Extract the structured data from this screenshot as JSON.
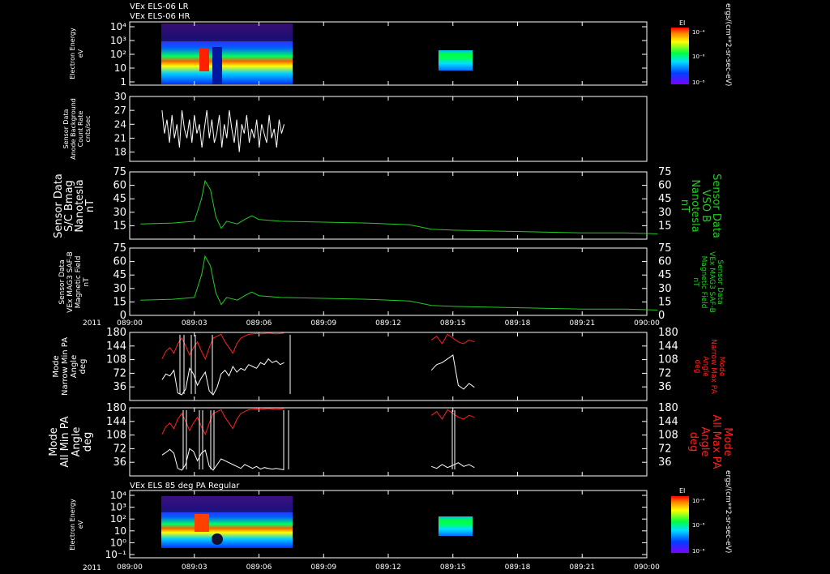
{
  "header": {
    "line1": "VEx ELS-06 LR",
    "line2": "VEx ELS-06 HR"
  },
  "time_axis": {
    "year": "2011",
    "ticks": [
      "089:00",
      "089:03",
      "089:06",
      "089:09",
      "089:12",
      "089:15",
      "089:18",
      "089:21",
      "090:00"
    ]
  },
  "colorbar": {
    "title": "EI",
    "unit": "ergs/(cm**2-sr-sec-eV)",
    "ticks": [
      "10⁻⁴",
      "10⁻⁶",
      "10⁻⁸"
    ]
  },
  "chart_data": [
    {
      "type": "heatmap",
      "id": "spectrogram-top",
      "ylabel": [
        "Electron Energy",
        "eV"
      ],
      "ytick_labels": [
        "10⁴",
        "10³",
        "10²",
        "10",
        "1"
      ],
      "data_blocks": [
        {
          "t_start": "089:01:30",
          "t_end": "089:07:15",
          "energy_min_eV": 3,
          "energy_max_eV": 20000
        },
        {
          "t_start": "089:14:00",
          "t_end": "089:15:30",
          "energy_min_eV": 10,
          "energy_max_eV": 200
        }
      ]
    },
    {
      "type": "line",
      "id": "anode-background",
      "ylabel": [
        "Sensor Data",
        "Anode Background",
        "Count Rate",
        "cnts/sec"
      ],
      "ylim": [
        16,
        30
      ],
      "yticks": [
        30,
        27,
        24,
        21,
        18
      ],
      "series": [
        {
          "color": "#ffffff",
          "t_start": "089:01:30",
          "t_end": "089:07:10",
          "values": [
            27,
            22,
            25,
            20,
            26,
            21,
            24,
            19,
            27,
            23,
            21,
            25,
            20,
            26,
            22,
            24,
            19,
            23,
            27,
            21,
            25,
            20,
            22,
            26,
            19,
            24,
            21,
            27,
            23,
            20,
            25,
            18,
            24,
            22,
            26,
            20,
            23,
            21,
            25,
            19,
            24,
            22,
            20,
            26,
            21,
            23,
            19,
            25,
            22,
            24
          ]
        }
      ]
    },
    {
      "type": "line",
      "id": "sc-bmag",
      "ylabel": [
        "Sensor Data",
        "S/C Bmag",
        "Nanotesla",
        "nT"
      ],
      "ylabel_right": [
        "Sensor Data",
        "VSO B",
        "Nanotesla",
        "nT"
      ],
      "ylim": [
        0,
        75
      ],
      "yticks": [
        75,
        60,
        45,
        30,
        15
      ],
      "series": [
        {
          "color": "#22cc22",
          "t": [
            "089:00:30",
            "089:02:00",
            "089:03:00",
            "089:03:20",
            "089:03:30",
            "089:03:45",
            "089:04:00",
            "089:04:15",
            "089:04:30",
            "089:05:00",
            "089:05:20",
            "089:05:40",
            "089:06:00",
            "089:07:00",
            "089:09:00",
            "089:11:00",
            "089:13:00",
            "089:14:00",
            "089:15:00",
            "089:17:00",
            "089:19:00",
            "089:21:00",
            "089:23:00",
            "089:24:30"
          ],
          "values": [
            17,
            18,
            20,
            45,
            65,
            55,
            25,
            12,
            20,
            17,
            22,
            26,
            22,
            20,
            19,
            18,
            16,
            11,
            10,
            9,
            8,
            7,
            7,
            6
          ]
        }
      ]
    },
    {
      "type": "line",
      "id": "mag-saf-b",
      "ylabel": [
        "Sensor Data",
        "VEx MAG3 SAF-B",
        "Magnetic Field",
        "nT"
      ],
      "ylabel_right": [
        "Sensor Data",
        "VEx MAG3 SAF-B",
        "Magnetic Field",
        "nT"
      ],
      "ylim": [
        0,
        75
      ],
      "yticks": [
        75,
        60,
        45,
        30,
        15,
        0
      ],
      "series": [
        {
          "color": "#22cc22",
          "t": [
            "089:00:30",
            "089:02:00",
            "089:03:00",
            "089:03:20",
            "089:03:30",
            "089:03:45",
            "089:04:00",
            "089:04:15",
            "089:04:30",
            "089:05:00",
            "089:05:20",
            "089:05:40",
            "089:06:00",
            "089:07:00",
            "089:09:00",
            "089:11:00",
            "089:13:00",
            "089:14:00",
            "089:15:00",
            "089:17:00",
            "089:19:00",
            "089:21:00",
            "089:23:00",
            "089:24:30"
          ],
          "values": [
            17,
            18,
            20,
            45,
            66,
            55,
            25,
            12,
            20,
            17,
            22,
            26,
            22,
            20,
            19,
            18,
            16,
            11,
            10,
            9,
            8,
            7,
            7,
            6
          ]
        }
      ]
    },
    {
      "type": "line",
      "id": "narrow-pa",
      "ylabel": [
        "Mode",
        "Narrow Min PA",
        "Angle",
        "deg"
      ],
      "ylabel_right": [
        "Mode",
        "Narrow Max PA",
        "Angle",
        "deg"
      ],
      "ylim": [
        0,
        180
      ],
      "yticks": [
        180,
        144,
        108,
        72,
        36
      ],
      "series": [
        {
          "color": "#ffffff",
          "segments": [
            {
              "t_start": "089:01:30",
              "t_end": "089:07:10",
              "values": [
                55,
                70,
                65,
                80,
                20,
                15,
                30,
                85,
                70,
                40,
                60,
                75,
                25,
                15,
                35,
                70,
                80,
                65,
                90,
                75,
                85,
                80,
                95,
                90,
                85,
                100,
                95,
                110,
                100,
                105,
                95,
                100
              ]
            },
            {
              "t_start": "089:14:00",
              "t_end": "089:16:00",
              "values": [
                80,
                95,
                100,
                110,
                120,
                40,
                30,
                45,
                35
              ]
            }
          ]
        },
        {
          "color": "#ff2020",
          "segments": [
            {
              "t_start": "089:01:30",
              "t_end": "089:07:10",
              "values": [
                110,
                130,
                140,
                125,
                150,
                165,
                145,
                120,
                140,
                155,
                130,
                110,
                140,
                165,
                170,
                175,
                155,
                140,
                125,
                150,
                165,
                170,
                175,
                176,
                177,
                176,
                177,
                178,
                177,
                176,
                177,
                178
              ]
            },
            {
              "t_start": "089:14:00",
              "t_end": "089:16:00",
              "values": [
                160,
                170,
                150,
                175,
                165,
                155,
                150,
                160,
                155
              ]
            }
          ]
        }
      ]
    },
    {
      "type": "line",
      "id": "all-pa",
      "ylabel": [
        "Mode",
        "All Min PA",
        "Angle",
        "deg"
      ],
      "ylabel_right": [
        "Mode",
        "All Max PA",
        "Angle",
        "deg"
      ],
      "ylim": [
        0,
        180
      ],
      "yticks": [
        180,
        144,
        108,
        72,
        36
      ],
      "series": [
        {
          "color": "#ffffff",
          "segments": [
            {
              "t_start": "089:01:30",
              "t_end": "089:07:10",
              "values": [
                55,
                62,
                70,
                60,
                20,
                15,
                30,
                72,
                65,
                40,
                60,
                68,
                25,
                15,
                30,
                45,
                40,
                35,
                30,
                25,
                20,
                30,
                25,
                20,
                25,
                18,
                22,
                20,
                18,
                20,
                18,
                16
              ]
            },
            {
              "t_start": "089:14:00",
              "t_end": "089:16:00",
              "values": [
                25,
                20,
                30,
                22,
                28,
                35,
                25,
                30,
                22
              ]
            }
          ]
        },
        {
          "color": "#ff2020",
          "segments": [
            {
              "t_start": "089:01:30",
              "t_end": "089:07:10",
              "values": [
                110,
                130,
                140,
                125,
                150,
                165,
                145,
                120,
                140,
                155,
                130,
                110,
                140,
                165,
                170,
                175,
                155,
                140,
                125,
                150,
                165,
                170,
                175,
                176,
                177,
                176,
                177,
                178,
                177,
                176,
                177,
                178
              ]
            },
            {
              "t_start": "089:14:00",
              "t_end": "089:16:00",
              "values": [
                160,
                170,
                150,
                175,
                165,
                155,
                150,
                160,
                155
              ]
            }
          ]
        }
      ]
    },
    {
      "type": "heatmap",
      "id": "spectrogram-bottom",
      "title": "VEx ELS 85 deg PA Regular",
      "ylabel": [
        "Electron Energy",
        "eV"
      ],
      "ytick_labels": [
        "10⁴",
        "10³",
        "10²",
        "10",
        "10⁰",
        "10⁻¹"
      ],
      "data_blocks": [
        {
          "t_start": "089:01:30",
          "t_end": "089:07:15",
          "energy_min_eV": 1,
          "energy_max_eV": 20000
        },
        {
          "t_start": "089:14:00",
          "t_end": "089:16:00",
          "energy_min_eV": 10,
          "energy_max_eV": 200
        }
      ]
    }
  ]
}
